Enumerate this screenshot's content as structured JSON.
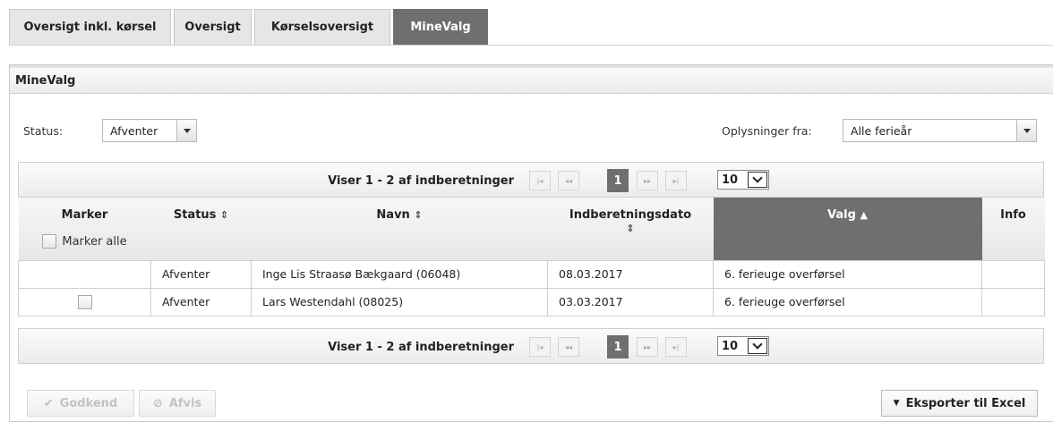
{
  "tabs": [
    {
      "label": "Oversigt inkl. kørsel",
      "active": false
    },
    {
      "label": "Oversigt",
      "active": false
    },
    {
      "label": "Kørselsoversigt",
      "active": false
    },
    {
      "label": "MineValg",
      "active": true
    }
  ],
  "panel": {
    "title": "MineValg"
  },
  "filters": {
    "status_label": "Status:",
    "status_value": "Afventer",
    "source_label": "Oplysninger fra:",
    "source_value": "Alle ferieår"
  },
  "pager": {
    "info": "Viser 1 - 2 af indberetninger",
    "current_page": "1",
    "page_size": "10",
    "first_icon": "first-page-icon",
    "prev_icon": "previous-page-icon",
    "next_icon": "next-page-icon",
    "last_icon": "last-page-icon"
  },
  "columns": {
    "marker": "Marker",
    "marker_all": "Marker alle",
    "status": "Status",
    "name": "Navn",
    "date": "Indberetningsdato",
    "choice": "Valg",
    "info": "Info",
    "sort_both": "⇕",
    "sort_asc": "▲"
  },
  "rows": [
    {
      "status": "Afventer",
      "name": "Inge Lis Straasø Bækgaard (06048)",
      "date": "08.03.2017",
      "choice": "6. ferieuge overførsel",
      "checkbox": false
    },
    {
      "status": "Afventer",
      "name": "Lars Westendahl (08025)",
      "date": "03.03.2017",
      "choice": "6. ferieuge overførsel",
      "checkbox": true
    }
  ],
  "actions": {
    "approve": "Godkend",
    "reject": "Afvis",
    "export": "Eksporter til Excel"
  },
  "colors": {
    "active_tab": "#6f6f6f",
    "disabled_text": "#c2c2c2"
  }
}
